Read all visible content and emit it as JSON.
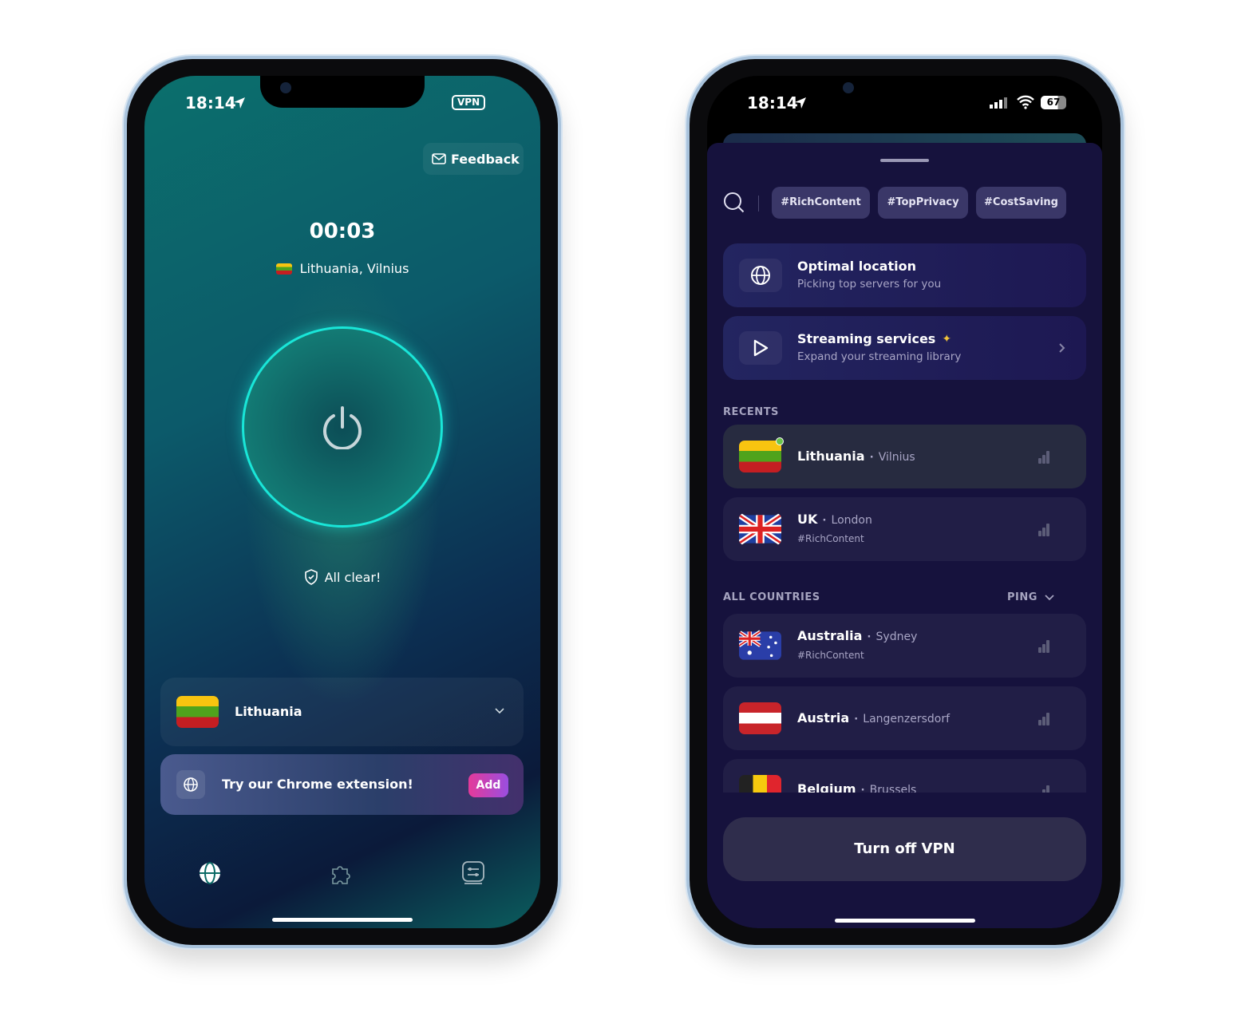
{
  "left_phone": {
    "status": {
      "time": "18:14",
      "vpn_badge": "VPN"
    },
    "feedback_label": "Feedback",
    "timer": "00:03",
    "location": "Lithuania, Vilnius",
    "power_ring_color": "#19e6d8",
    "status_text": "All clear!",
    "country_selector": {
      "label": "Lithuania"
    },
    "promo": {
      "text": "Try our Chrome extension!",
      "button": "Add"
    },
    "bottom_nav": [
      {
        "icon": "globe-icon",
        "active": true
      },
      {
        "icon": "puzzle-icon"
      },
      {
        "icon": "settings-icon"
      }
    ]
  },
  "right_phone": {
    "status": {
      "time": "18:14",
      "battery": "67"
    },
    "tags": [
      "#RichContent",
      "#TopPrivacy",
      "#CostSaving"
    ],
    "quick": [
      {
        "title": "Optimal location",
        "subtitle": "Picking top servers for you",
        "icon": "globe-icon"
      },
      {
        "title": "Streaming services",
        "subtitle": "Expand your streaming library",
        "icon": "play-icon"
      }
    ],
    "recents_label": "RECENTS",
    "recents": [
      {
        "country": "Lithuania",
        "city": "Vilnius",
        "connected": true
      },
      {
        "country": "UK",
        "city": "London",
        "tag": "#RichContent"
      }
    ],
    "all_countries_label": "ALL COUNTRIES",
    "sort_label": "PING",
    "countries": [
      {
        "country": "Australia",
        "city": "Sydney",
        "tag": "#RichContent"
      },
      {
        "country": "Austria",
        "city": "Langenzersdorf"
      },
      {
        "country": "Belgium",
        "city": "Brussels"
      }
    ],
    "turn_off_label": "Turn off VPN",
    "accent_connected": "#6ac24a"
  }
}
